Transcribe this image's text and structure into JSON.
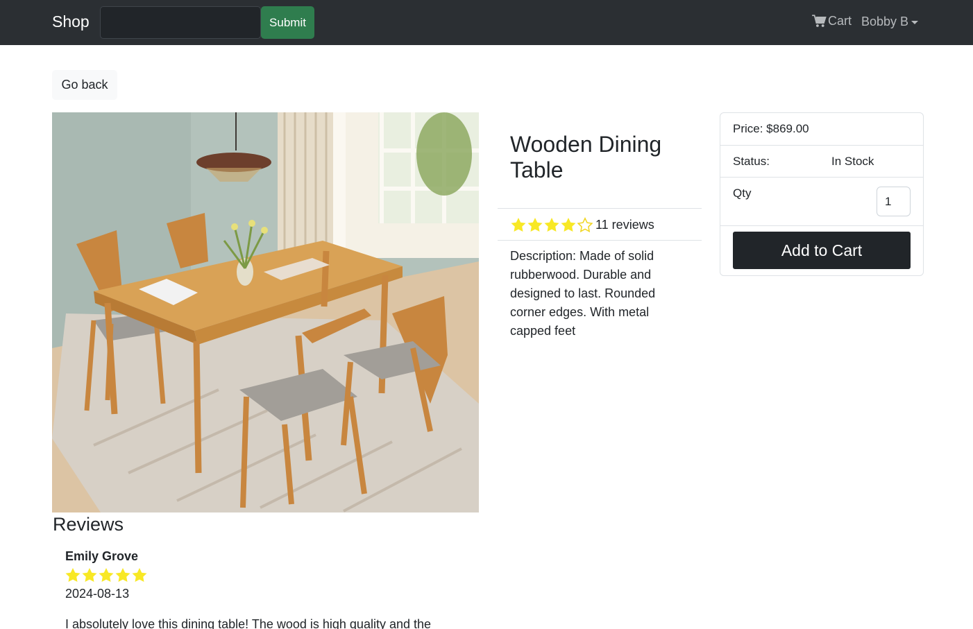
{
  "navbar": {
    "brand": "Shop",
    "search": {
      "value": "",
      "placeholder": ""
    },
    "submit_label": "Submit",
    "cart_label": "Cart",
    "user_label": "Bobby B"
  },
  "back_label": "Go back",
  "product": {
    "title": "Wooden Dining Table",
    "image_alt": "Wooden dining table with four chairs",
    "rating": 4,
    "rating_max": 5,
    "reviews_text": "11 reviews",
    "description": "Description: Made of solid rubberwood. Durable and designed to last. Rounded corner edges. With metal capped feet"
  },
  "purchase": {
    "price_text": "Price: $869.00",
    "status_label": "Status:",
    "status_value": "In Stock",
    "qty_label": "Qty",
    "qty_value": "1",
    "add_label": "Add to Cart"
  },
  "reviews": {
    "heading": "Reviews",
    "items": [
      {
        "name": "Emily Grove",
        "rating": 5,
        "date": "2024-08-13",
        "text": "I absolutely love this dining table! The wood is high quality and the"
      }
    ]
  },
  "colors": {
    "navbar": "#2b2f33",
    "submit": "#2f7d4e",
    "star": "#f8e825",
    "dark_button": "#212529"
  }
}
